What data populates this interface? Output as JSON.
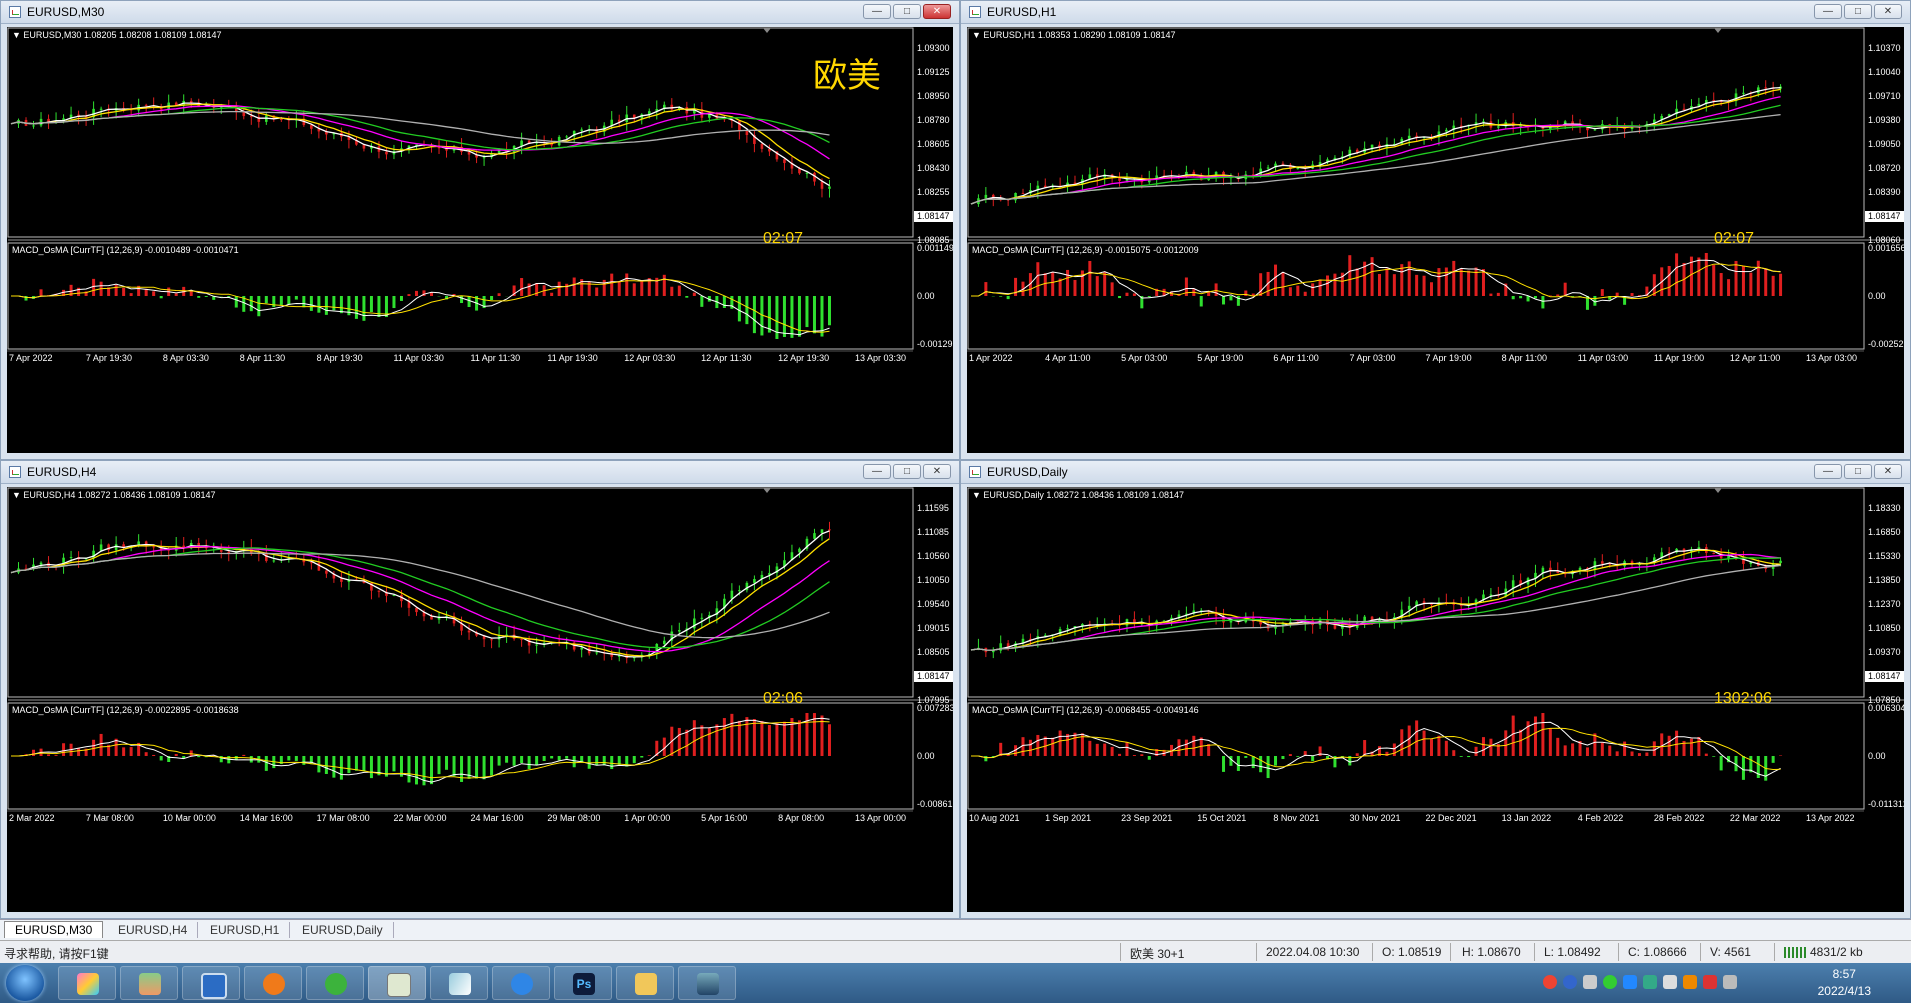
{
  "windows": [
    {
      "id": "m30",
      "title": "EURUSD,M30",
      "info": "EURUSD,M30  1.08205 1.08208 1.08109 1.08147",
      "prices": [
        "1.09300",
        "1.09125",
        "1.08950",
        "1.08780",
        "1.08605",
        "1.08430",
        "1.08255",
        "1.08147",
        "1.08085"
      ],
      "macd": "MACD_OsMA [CurrTF] (12,26,9) -0.0010489 -0.0010471",
      "macd_scale": [
        "0.001149",
        "0.00",
        "-0.00129"
      ],
      "time": [
        "7 Apr 2022",
        "7 Apr 19:30",
        "8 Apr 03:30",
        "8 Apr 11:30",
        "8 Apr 19:30",
        "11 Apr 03:30",
        "11 Apr 11:30",
        "11 Apr 19:30",
        "12 Apr 03:30",
        "12 Apr 11:30",
        "12 Apr 19:30",
        "13 Apr 03:30"
      ],
      "overlay": "欧美",
      "countdown": "02:07"
    },
    {
      "id": "h1",
      "title": "EURUSD,H1",
      "info": "EURUSD,H1  1.08353 1.08290 1.08109 1.08147",
      "prices": [
        "1.10370",
        "1.10040",
        "1.09710",
        "1.09380",
        "1.09050",
        "1.08720",
        "1.08390",
        "1.08147",
        "1.08060"
      ],
      "macd": "MACD_OsMA [CurrTF] (12,26,9) -0.0015075 -0.0012009",
      "macd_scale": [
        "0.001656",
        "0.00",
        "-0.002521"
      ],
      "time": [
        "1 Apr 2022",
        "4 Apr 11:00",
        "5 Apr 03:00",
        "5 Apr 19:00",
        "6 Apr 11:00",
        "7 Apr 03:00",
        "7 Apr 19:00",
        "8 Apr 11:00",
        "11 Apr 03:00",
        "11 Apr 19:00",
        "12 Apr 11:00",
        "13 Apr 03:00"
      ],
      "overlay": "",
      "countdown": "02:07"
    },
    {
      "id": "h4",
      "title": "EURUSD,H4",
      "info": "EURUSD,H4  1.08272 1.08436 1.08109 1.08147",
      "prices": [
        "1.11595",
        "1.11085",
        "1.10560",
        "1.10050",
        "1.09540",
        "1.09015",
        "1.08505",
        "1.08147",
        "1.07995"
      ],
      "macd": "MACD_OsMA [CurrTF] (12,26,9) -0.0022895 -0.0018638",
      "macd_scale": [
        "0.007283",
        "0.00",
        "-0.00861"
      ],
      "time": [
        "2 Mar 2022",
        "7 Mar 08:00",
        "10 Mar 00:00",
        "14 Mar 16:00",
        "17 Mar 08:00",
        "22 Mar 00:00",
        "24 Mar 16:00",
        "29 Mar 08:00",
        "1 Apr 00:00",
        "5 Apr 16:00",
        "8 Apr 08:00",
        "13 Apr 00:00"
      ],
      "overlay": "",
      "countdown": "02:06"
    },
    {
      "id": "d1",
      "title": "EURUSD,Daily",
      "info": "EURUSD,Daily  1.08272 1.08436 1.08109 1.08147",
      "prices": [
        "1.18330",
        "1.16850",
        "1.15330",
        "1.13850",
        "1.12370",
        "1.10850",
        "1.09370",
        "1.08147",
        "1.07850"
      ],
      "macd": "MACD_OsMA [CurrTF] (12,26,9) -0.0068455 -0.0049146",
      "macd_scale": [
        "0.006304",
        "0.00",
        "-0.011312"
      ],
      "time": [
        "10 Aug 2021",
        "1 Sep 2021",
        "23 Sep 2021",
        "15 Oct 2021",
        "8 Nov 2021",
        "30 Nov 2021",
        "22 Dec 2021",
        "13 Jan 2022",
        "4 Feb 2022",
        "28 Feb 2022",
        "22 Mar 2022",
        "13 Apr 2022"
      ],
      "overlay": "",
      "countdown": "1302:06"
    }
  ],
  "tabs": [
    "EURUSD,M30",
    "EURUSD,H4",
    "EURUSD,H1",
    "EURUSD,Daily"
  ],
  "status": {
    "help": "寻求帮助, 请按F1键",
    "profile": "欧美 30+1",
    "datetime": "2022.04.08 10:30",
    "open": "O: 1.08519",
    "high": "H: 1.08670",
    "low": "L: 1.08492",
    "close": "C: 1.08666",
    "volume": "V: 4561",
    "traffic": "4831/2 kb"
  },
  "clock": {
    "time": "8:57",
    "date": "2022/4/13"
  },
  "colors": {
    "bull": "#2fe02f",
    "bear": "#e01f1f",
    "ma_white": "#ffffff",
    "ma_yellow": "#ffe000",
    "ma_magenta": "#ff00ff",
    "ma_green": "#22cc22",
    "ma_gray": "#b0b0b0",
    "label": "#ffd700"
  }
}
